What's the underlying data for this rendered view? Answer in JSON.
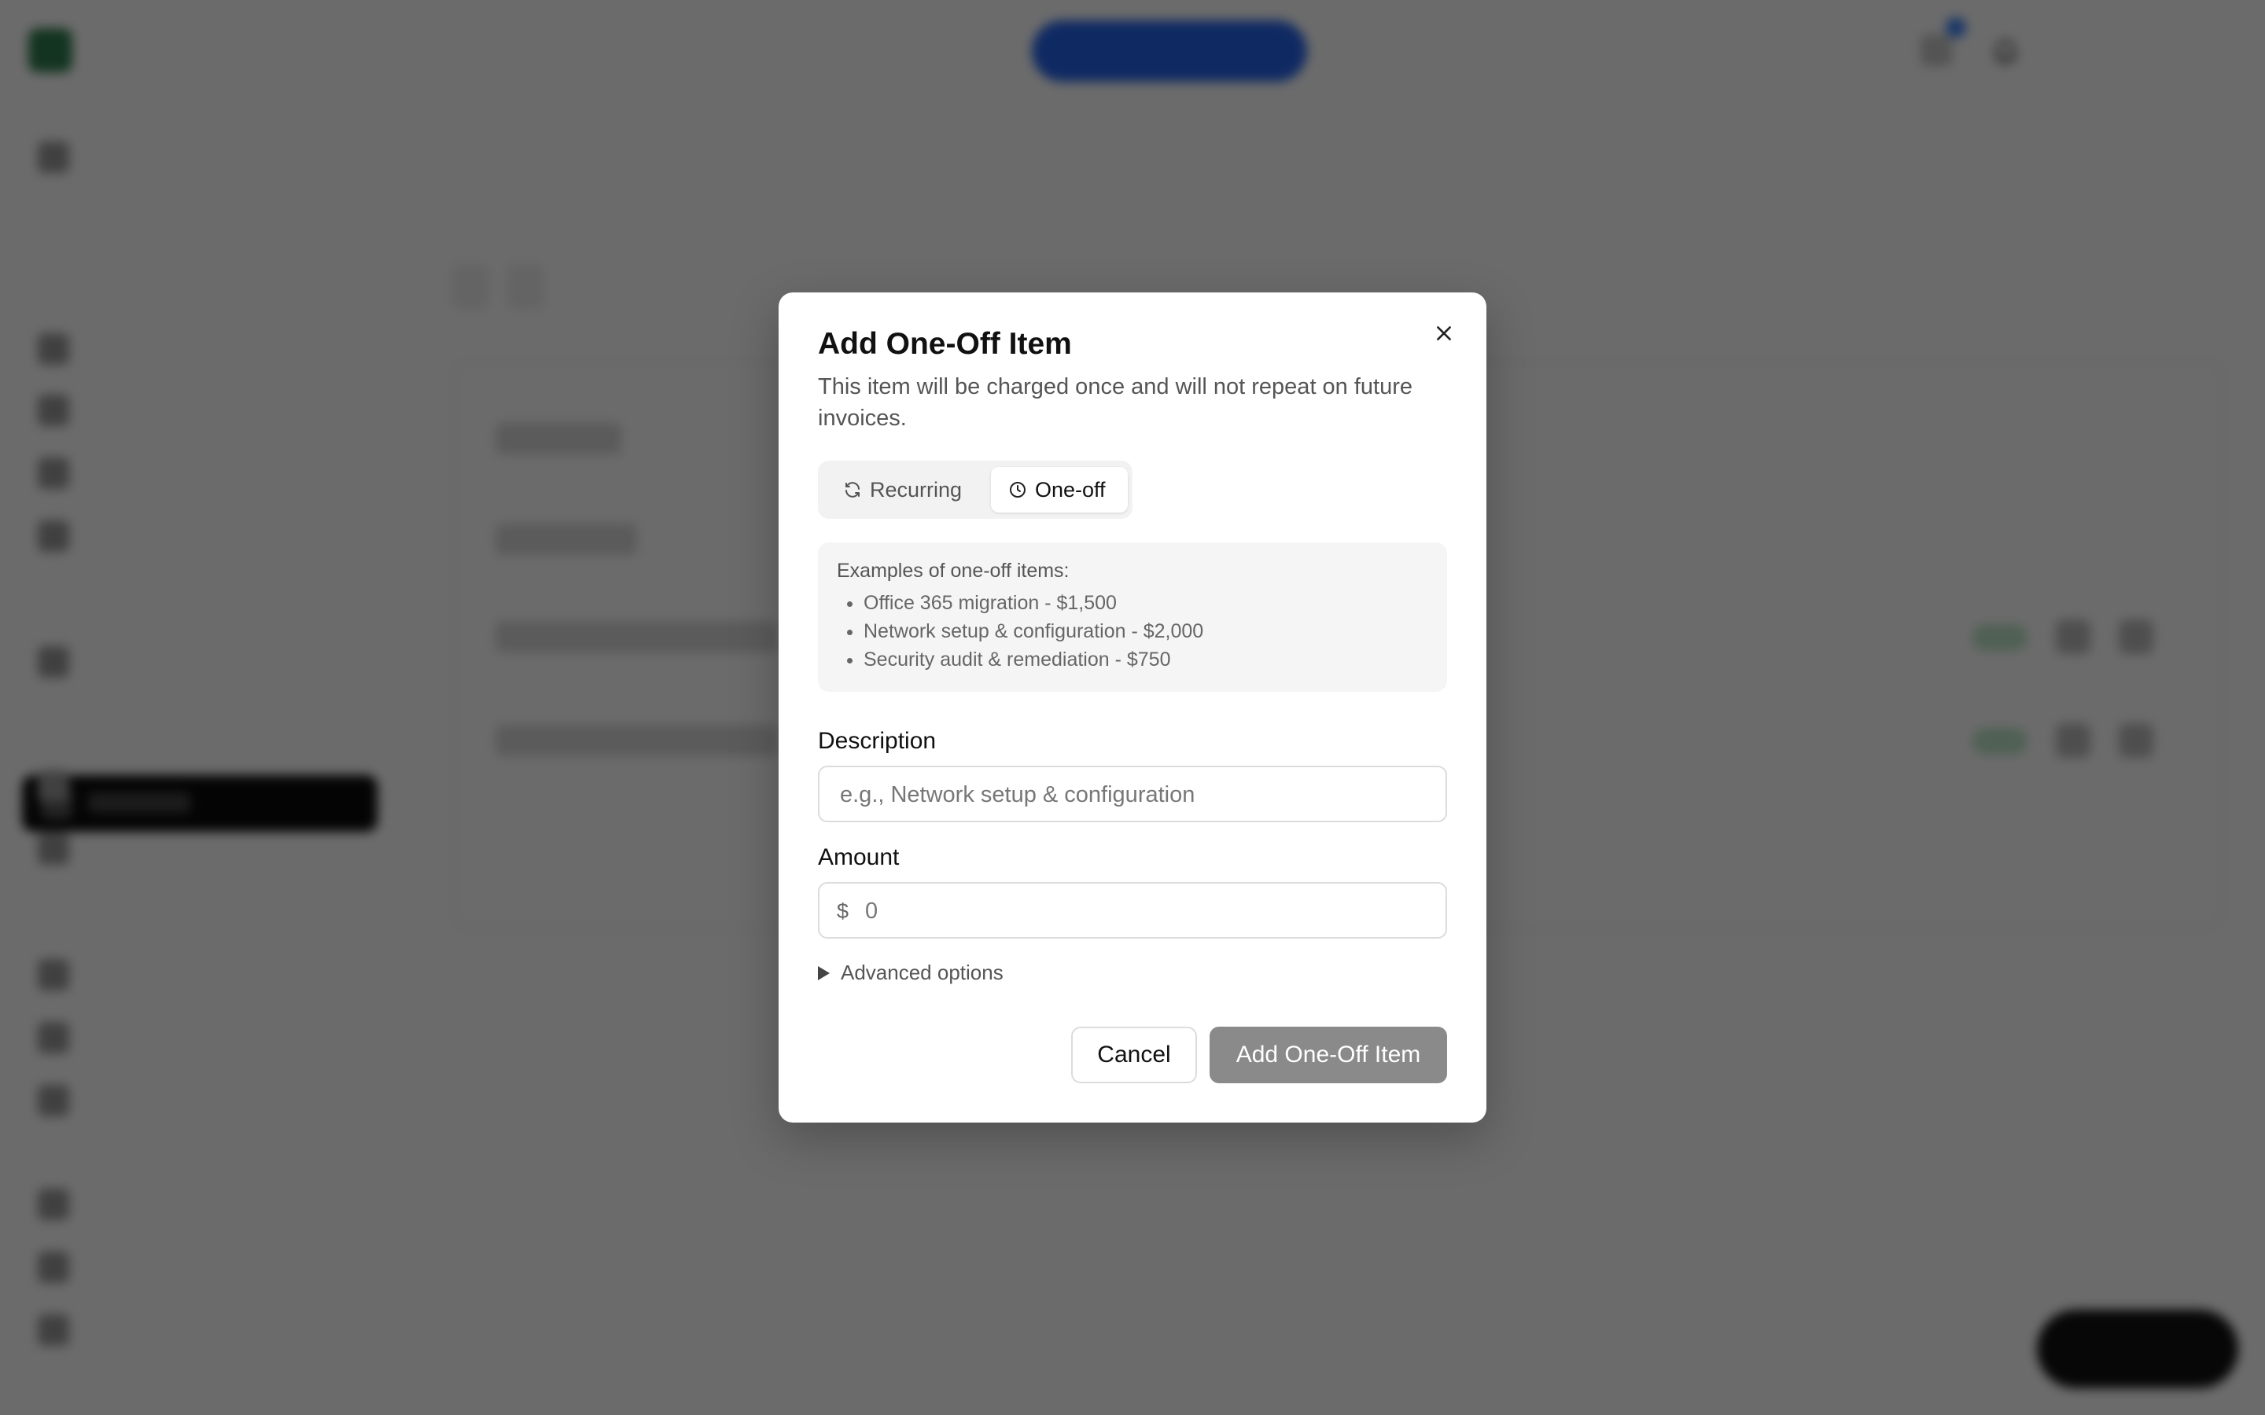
{
  "modal": {
    "title": "Add One-Off Item",
    "description": "This item will be charged once and will not repeat on future invoices.",
    "segment": {
      "recurring_label": "Recurring",
      "oneoff_label": "One-off",
      "selected": "One-off"
    },
    "examples": {
      "title": "Examples of one-off items:",
      "items": [
        "Office 365 migration - $1,500",
        "Network setup & configuration - $2,000",
        "Security audit & remediation - $750"
      ]
    },
    "description_field": {
      "label": "Description",
      "placeholder": "e.g., Network setup & configuration",
      "value": ""
    },
    "amount_field": {
      "label": "Amount",
      "currency_symbol": "$",
      "placeholder": "0",
      "value": ""
    },
    "advanced_label": "Advanced options",
    "cancel_label": "Cancel",
    "submit_label": "Add One-Off Item"
  },
  "colors": {
    "overlay": "#000000",
    "submit_disabled": "#8a8a8a",
    "accent": "#2563eb"
  },
  "icons": {
    "close": "close-icon",
    "recurring": "refresh-icon",
    "oneoff": "clock-icon",
    "advanced": "triangle-right-icon"
  }
}
